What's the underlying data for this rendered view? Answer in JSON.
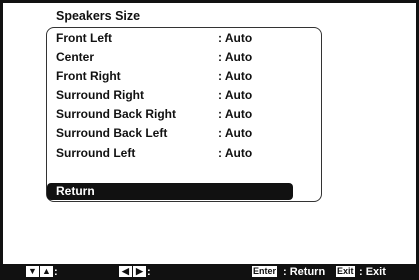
{
  "title": "Speakers Size",
  "rows": [
    {
      "label": "Front Left",
      "value": ": Auto"
    },
    {
      "label": "Center",
      "value": ": Auto"
    },
    {
      "label": "Front Right",
      "value": ": Auto"
    },
    {
      "label": "Surround Right",
      "value": ": Auto"
    },
    {
      "label": "Surround Back Right",
      "value": ": Auto"
    },
    {
      "label": "Surround Back Left",
      "value": ": Auto"
    },
    {
      "label": "Surround Left",
      "value": ": Auto"
    }
  ],
  "return_label": "Return",
  "footer": {
    "updown_suffix": ":",
    "leftright_suffix": ":",
    "enter_key": "Enter",
    "enter_action": ": Return",
    "exit_key": "Exit",
    "exit_action": ": Exit"
  }
}
